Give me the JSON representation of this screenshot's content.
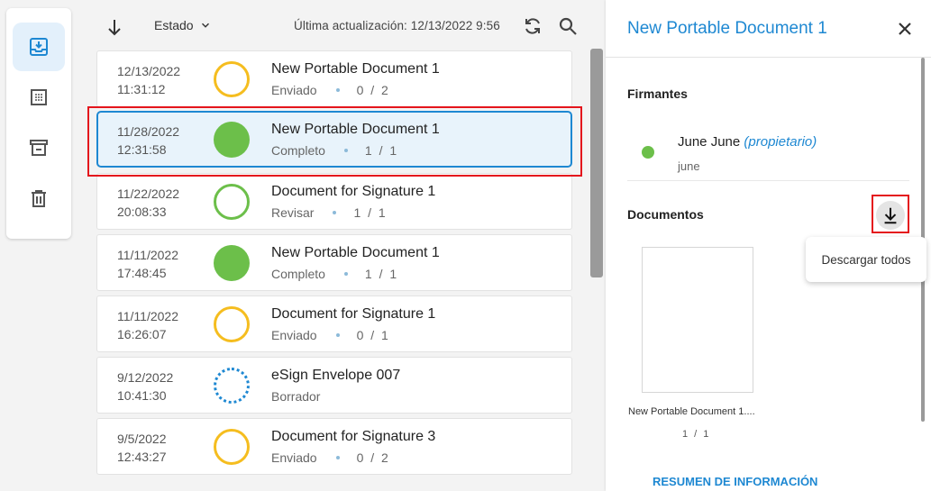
{
  "nav": {
    "items": [
      {
        "name": "inbox",
        "icon": "inbox-download-icon",
        "active": true
      },
      {
        "name": "grid",
        "icon": "dotted-grid-icon",
        "active": false
      },
      {
        "name": "archive",
        "icon": "archive-icon",
        "active": false
      },
      {
        "name": "trash",
        "icon": "trash-icon",
        "active": false
      }
    ]
  },
  "toolbar": {
    "status_filter": "Estado",
    "last_updated": "Última actualización:  12/13/2022 9:56"
  },
  "envelopes": [
    {
      "date": "12/13/2022",
      "time": "11:31:12",
      "title": "New Portable Document 1",
      "status": "Enviado",
      "count": "0 / 2",
      "state": "sent"
    },
    {
      "date": "11/28/2022",
      "time": "12:31:58",
      "title": "New Portable Document 1",
      "status": "Completo",
      "count": "1 / 1",
      "state": "complete"
    },
    {
      "date": "11/22/2022",
      "time": "20:08:33",
      "title": "Document for Signature 1",
      "status": "Revisar",
      "count": "1 / 1",
      "state": "review"
    },
    {
      "date": "11/11/2022",
      "time": "17:48:45",
      "title": "New Portable Document 1",
      "status": "Completo",
      "count": "1 / 1",
      "state": "complete"
    },
    {
      "date": "11/11/2022",
      "time": "16:26:07",
      "title": "Document for Signature 1",
      "status": "Enviado",
      "count": "0 / 1",
      "state": "sent"
    },
    {
      "date": "9/12/2022",
      "time": "10:41:30",
      "title": "eSign Envelope 007",
      "status": "Borrador",
      "count": "",
      "state": "draft"
    },
    {
      "date": "9/5/2022",
      "time": "12:43:27",
      "title": "Document for Signature 3",
      "status": "Enviado",
      "count": "0 / 2",
      "state": "sent"
    }
  ],
  "detail": {
    "title": "New Portable Document 1",
    "signers_heading": "Firmantes",
    "signer_name": "June June",
    "signer_role": "(propietario)",
    "signer_sub": "june",
    "documents_heading": "Documentos",
    "document_name": "New Portable Document 1....",
    "document_count": "1 / 1",
    "summary_link": "RESUMEN DE INFORMACIÓN",
    "download_tooltip": "Descargar todos"
  },
  "colors": {
    "accent": "#1e88d2",
    "sent": "#f5bd1f",
    "complete": "#6cbf4a",
    "highlight": "#e4151c"
  }
}
